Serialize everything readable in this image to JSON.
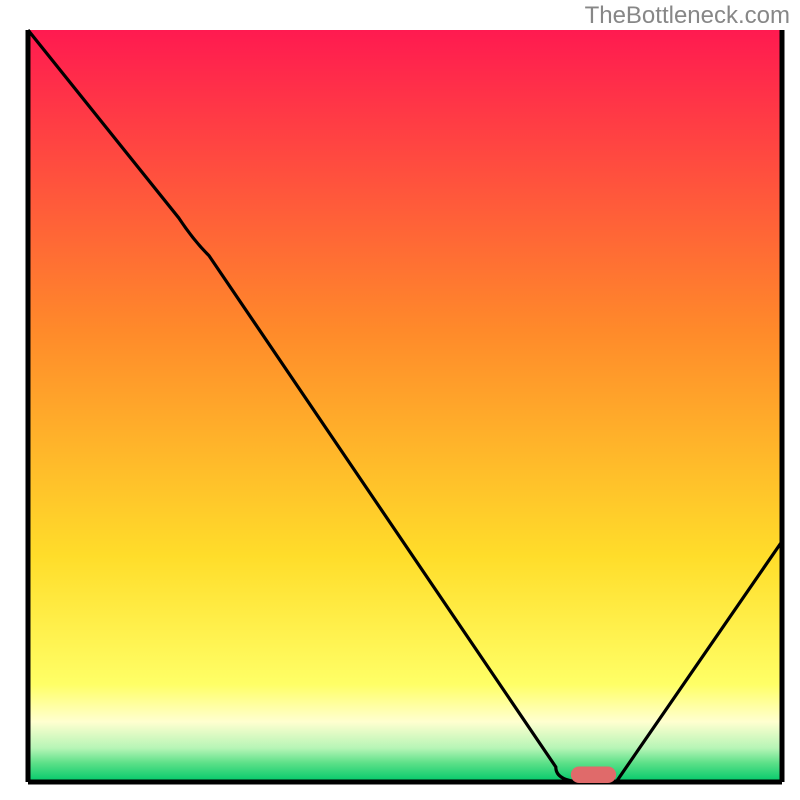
{
  "watermark": "TheBottleneck.com",
  "chart_data": {
    "type": "line",
    "title": "",
    "xlabel": "",
    "ylabel": "",
    "xlim": [
      0,
      100
    ],
    "ylim": [
      0,
      100
    ],
    "grid": false,
    "legend": false,
    "gradient_stops": [
      {
        "offset": 0.0,
        "color": "#ff1a50"
      },
      {
        "offset": 0.4,
        "color": "#ff8a2a"
      },
      {
        "offset": 0.7,
        "color": "#ffdd2a"
      },
      {
        "offset": 0.87,
        "color": "#ffff66"
      },
      {
        "offset": 0.92,
        "color": "#ffffd0"
      },
      {
        "offset": 0.955,
        "color": "#b6f5b6"
      },
      {
        "offset": 0.975,
        "color": "#5ce088"
      },
      {
        "offset": 1.0,
        "color": "#00c86a"
      }
    ],
    "series": [
      {
        "name": "bottleneck-curve",
        "x": [
          0,
          20,
          24,
          70,
          74,
          78,
          100
        ],
        "y": [
          100,
          75,
          70,
          2,
          0,
          0,
          32
        ]
      }
    ],
    "marker": {
      "name": "optimal-zone",
      "x": 75,
      "y": 0,
      "width": 6,
      "height": 2.2,
      "color": "#e06a6a",
      "rx": 50
    },
    "axis_color": "#000000"
  }
}
